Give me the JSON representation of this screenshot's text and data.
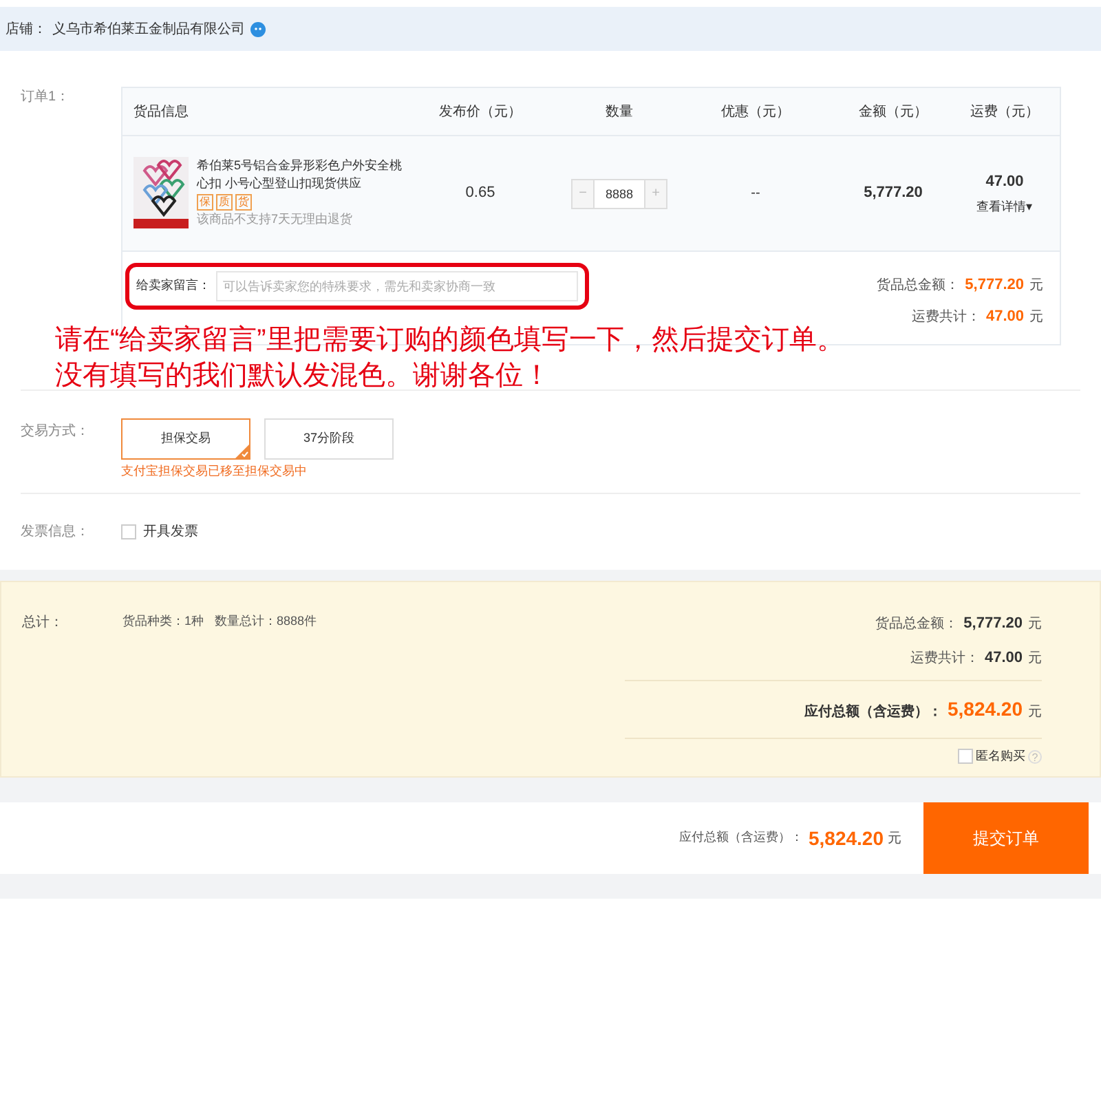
{
  "store": {
    "label": "店铺：",
    "name": "义乌市希伯莱五金制品有限公司"
  },
  "order": {
    "label": "订单1：",
    "columns": [
      "货品信息",
      "发布价（元）",
      "数量",
      "优惠（元）",
      "金额（元）",
      "运费（元）"
    ],
    "item": {
      "title": "希伯莱5号铝合金异形彩色户外安全桃心扣 小号心型登山扣现货供应",
      "badges": [
        "保",
        "质",
        "货"
      ],
      "note": "该商品不支持7天无理由退货",
      "price": "0.65",
      "quantity": "8888",
      "minus": "−",
      "plus": "+",
      "discount": "--",
      "amount": "5,777.20",
      "shipping": "47.00",
      "details": "查看详情",
      "caret": "▾"
    },
    "message": {
      "label": "给卖家留言：",
      "placeholder": "可以告诉卖家您的特殊要求，需先和卖家协商一致"
    },
    "subtotals": [
      {
        "label": "货品总金额：",
        "value": "5,777.20",
        "unit": "元"
      },
      {
        "label": "运费共计：",
        "value": "47.00",
        "unit": "元"
      }
    ]
  },
  "annotation": {
    "lines": [
      "请在“给卖家留言”里把需要订购的颜色填写一下，然后提交订单。",
      "没有填写的我们默认发混色。谢谢各位！"
    ]
  },
  "trade": {
    "label": "交易方式：",
    "options": [
      {
        "label": "担保交易",
        "selected": true
      },
      {
        "label": "37分阶段",
        "selected": false
      }
    ],
    "hint": "支付宝担保交易已移至担保交易中"
  },
  "invoice": {
    "label": "发票信息：",
    "option": "开具发票",
    "checked": false
  },
  "summary": {
    "label": "总计：",
    "kinds": "货品种类：1种",
    "count": "数量总计：8888件",
    "lines": [
      {
        "label": "货品总金额：",
        "value": "5,777.20",
        "unit": "元"
      },
      {
        "label": "运费共计：",
        "value": "47.00",
        "unit": "元"
      }
    ],
    "total": {
      "label": "应付总额（含运费）：",
      "value": "5,824.20",
      "unit": "元"
    },
    "anonymous": {
      "label": "匿名购买",
      "checked": false,
      "help": "?"
    }
  },
  "footer": {
    "label": "应付总额（含运费）：",
    "value": "5,824.20",
    "unit": "元",
    "submit": "提交订单"
  }
}
